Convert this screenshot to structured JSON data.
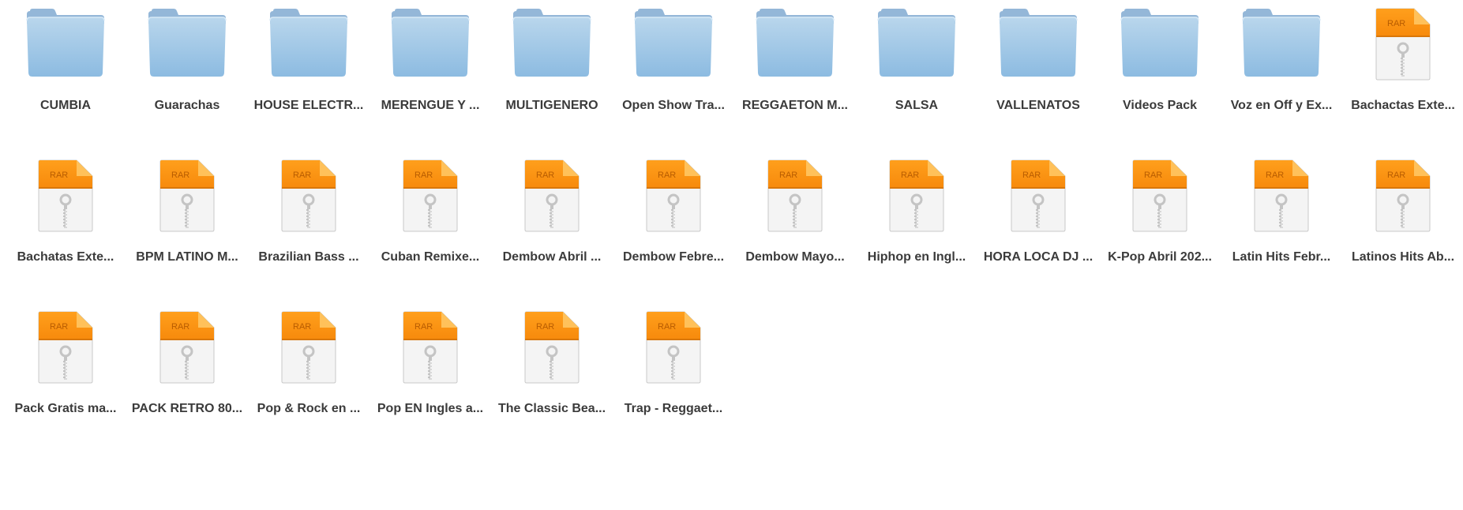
{
  "items": [
    {
      "name": "CUMBIA",
      "type": "folder",
      "icon": "folder-icon"
    },
    {
      "name": "Guarachas",
      "type": "folder",
      "icon": "folder-icon"
    },
    {
      "name": "HOUSE ELECTR...",
      "type": "folder",
      "icon": "folder-icon"
    },
    {
      "name": "MERENGUE Y ...",
      "type": "folder",
      "icon": "folder-icon"
    },
    {
      "name": "MULTIGENERO",
      "type": "folder",
      "icon": "folder-icon"
    },
    {
      "name": "Open Show Tra...",
      "type": "folder",
      "icon": "folder-icon"
    },
    {
      "name": "REGGAETON M...",
      "type": "folder",
      "icon": "folder-icon"
    },
    {
      "name": "SALSA",
      "type": "folder",
      "icon": "folder-icon"
    },
    {
      "name": "VALLENATOS",
      "type": "folder",
      "icon": "folder-icon"
    },
    {
      "name": "Videos Pack",
      "type": "folder",
      "icon": "folder-icon"
    },
    {
      "name": "Voz en Off y Ex...",
      "type": "folder",
      "icon": "folder-icon"
    },
    {
      "name": "Bachactas Exte...",
      "type": "rar",
      "icon": "rar-archive-icon"
    },
    {
      "name": "Bachatas Exte...",
      "type": "rar",
      "icon": "rar-archive-icon"
    },
    {
      "name": "BPM LATINO M...",
      "type": "rar",
      "icon": "rar-archive-icon"
    },
    {
      "name": "Brazilian Bass ...",
      "type": "rar",
      "icon": "rar-archive-icon"
    },
    {
      "name": "Cuban Remixe...",
      "type": "rar",
      "icon": "rar-archive-icon"
    },
    {
      "name": "Dembow Abril ...",
      "type": "rar",
      "icon": "rar-archive-icon"
    },
    {
      "name": "Dembow Febre...",
      "type": "rar",
      "icon": "rar-archive-icon"
    },
    {
      "name": "Dembow Mayo...",
      "type": "rar",
      "icon": "rar-archive-icon"
    },
    {
      "name": "Hiphop en Ingl...",
      "type": "rar",
      "icon": "rar-archive-icon"
    },
    {
      "name": "HORA LOCA DJ ...",
      "type": "rar",
      "icon": "rar-archive-icon"
    },
    {
      "name": "K-Pop Abril 202...",
      "type": "rar",
      "icon": "rar-archive-icon"
    },
    {
      "name": "Latin Hits Febr...",
      "type": "rar",
      "icon": "rar-archive-icon"
    },
    {
      "name": "Latinos Hits Ab...",
      "type": "rar",
      "icon": "rar-archive-icon"
    },
    {
      "name": "Pack Gratis ma...",
      "type": "rar",
      "icon": "rar-archive-icon"
    },
    {
      "name": "PACK RETRO 80...",
      "type": "rar",
      "icon": "rar-archive-icon"
    },
    {
      "name": "Pop & Rock en ...",
      "type": "rar",
      "icon": "rar-archive-icon"
    },
    {
      "name": "Pop EN Ingles a...",
      "type": "rar",
      "icon": "rar-archive-icon"
    },
    {
      "name": "The Classic Bea...",
      "type": "rar",
      "icon": "rar-archive-icon"
    },
    {
      "name": "Trap - Reggaet...",
      "type": "rar",
      "icon": "rar-archive-icon"
    }
  ],
  "rar_badge": "RAR",
  "colors": {
    "folder_top": "#b4d2ea",
    "folder_bottom": "#8fbde2",
    "folder_tab": "#94b6d6",
    "rar_orange": "#f7941d",
    "rar_orange_light": "#ffb74d",
    "label_text": "#3b3b3b"
  }
}
